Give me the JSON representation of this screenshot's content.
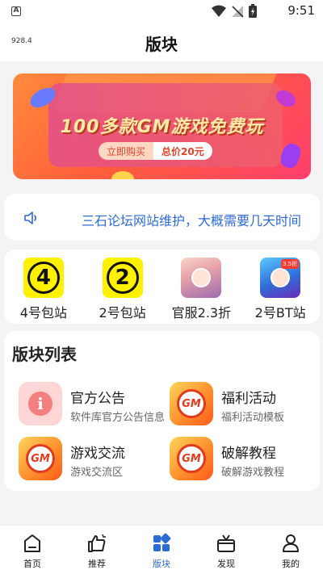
{
  "status_bar": {
    "time": "9:51",
    "notification_letter": "A"
  },
  "header": {
    "speed": "928.4",
    "title": "版块"
  },
  "banner": {
    "headline": "100多款GM游戏免费玩",
    "buy_label": "立即购买",
    "price_label": "总价20元",
    "colors": {
      "accent": "#ff5e3a",
      "headline": "#ffe9a8"
    }
  },
  "notice": {
    "text": "三石论坛网站维护，大概需要几天时间"
  },
  "quick_links": [
    {
      "label": "4号包站",
      "glyph": "4",
      "icon": "number-4-icon"
    },
    {
      "label": "2号包站",
      "glyph": "2",
      "icon": "number-2-icon"
    },
    {
      "label": "官服2.3折",
      "icon": "game-character-icon"
    },
    {
      "label": "2号BT站",
      "tag": "3.5折",
      "icon": "game-character-icon"
    }
  ],
  "sections": {
    "title": "版块列表",
    "items": [
      {
        "name": "官方公告",
        "desc": "软件库官方公告信息",
        "icon": "info-icon"
      },
      {
        "name": "福利活动",
        "desc": "福利活动模板",
        "icon": "gm-icon",
        "logo_text": "GM"
      },
      {
        "name": "游戏交流",
        "desc": "游戏交流区",
        "icon": "gm-icon",
        "logo_text": "GM"
      },
      {
        "name": "破解教程",
        "desc": "破解游戏教程",
        "icon": "gm-icon",
        "logo_text": "GM"
      }
    ]
  },
  "tabs": [
    {
      "label": "首页",
      "icon": "home-icon",
      "active": false
    },
    {
      "label": "推荐",
      "icon": "thumbs-up-icon",
      "active": false
    },
    {
      "label": "版块",
      "icon": "grid-icon",
      "active": true
    },
    {
      "label": "发现",
      "icon": "gift-icon",
      "active": false
    },
    {
      "label": "我的",
      "icon": "user-icon",
      "active": false
    }
  ],
  "colors": {
    "active_tab": "#2c6bd6",
    "notice_text": "#2c6bd6",
    "background": "#f4f4f6"
  }
}
